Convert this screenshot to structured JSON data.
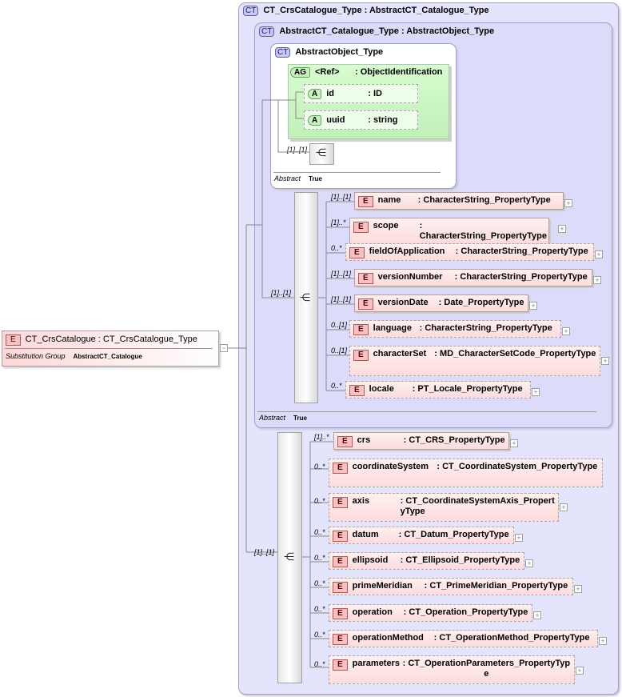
{
  "root": {
    "badge": "E",
    "name": "CT_CrsCatalogue",
    "type": ": CT_CrsCatalogue_Type",
    "subst_label": "Substitution Group",
    "subst_value": "AbstractCT_Catalogue"
  },
  "outer": {
    "badge": "CT",
    "title": "CT_CrsCatalogue_Type : AbstractCT_Catalogue_Type"
  },
  "inner": {
    "badge": "CT",
    "title": "AbstractCT_Catalogue_Type : AbstractObject_Type",
    "abstract_label": "Abstract",
    "abstract_value": "True"
  },
  "obj": {
    "badge": "CT",
    "title": "AbstractObject_Type",
    "abstract_label": "Abstract",
    "abstract_value": "True",
    "seq_occ": "[1]..[1]"
  },
  "ag": {
    "badge": "AG",
    "name": "<Ref>",
    "type": ": ObjectIdentification",
    "attrs": [
      {
        "badge": "A",
        "name": "id",
        "type": ": ID"
      },
      {
        "badge": "A",
        "name": "uuid",
        "type": ": string"
      }
    ]
  },
  "seq1_occ": "[1]..[1]",
  "seq1": [
    {
      "name": "name",
      "type": ": CharacterString_PropertyType",
      "occ": "[1]..[1]"
    },
    {
      "name": "scope",
      "type": ": CharacterString_PropertyType",
      "occ": "[1]..*"
    },
    {
      "name": "fieldOfApplication",
      "type": ": CharacterString_PropertyType",
      "occ": "0..*"
    },
    {
      "name": "versionNumber",
      "type": ": CharacterString_PropertyType",
      "occ": "[1]..[1]"
    },
    {
      "name": "versionDate",
      "type": ": Date_PropertyType",
      "occ": "[1]..[1]"
    },
    {
      "name": "language",
      "type": ": CharacterString_PropertyType",
      "occ": "0..[1]"
    },
    {
      "name": "characterSet",
      "type": ": MD_CharacterSetCode_PropertyType",
      "occ": "0..[1]"
    },
    {
      "name": "locale",
      "type": ": PT_Locale_PropertyType",
      "occ": "0..*"
    }
  ],
  "seq2_occ": "[1]..[1]",
  "seq2": [
    {
      "name": "crs",
      "type": ": CT_CRS_PropertyType",
      "occ": "[1]..*"
    },
    {
      "name": "coordinateSystem",
      "type": ": CT_CoordinateSystem_PropertyType",
      "occ": "0..*"
    },
    {
      "name": "axis",
      "type": ": CT_CoordinateSystemAxis_PropertyType",
      "occ": "0..*"
    },
    {
      "name": "datum",
      "type": ": CT_Datum_PropertyType",
      "occ": "0..*"
    },
    {
      "name": "ellipsoid",
      "type": ": CT_Ellipsoid_PropertyType",
      "occ": "0..*"
    },
    {
      "name": "primeMeridian",
      "type": ": CT_PrimeMeridian_PropertyType",
      "occ": "0..*"
    },
    {
      "name": "operation",
      "type": ": CT_Operation_PropertyType",
      "occ": "0..*"
    },
    {
      "name": "operationMethod",
      "type": ": CT_OperationMethod_PropertyType",
      "occ": "0..*"
    },
    {
      "name": "parameters",
      "type": ": CT_OperationParameters_PropertyType",
      "occ": "0..*"
    }
  ],
  "icons": {
    "badge_element": "E",
    "plus": "+",
    "minus": "−",
    "sequence": "sequence-icon"
  }
}
